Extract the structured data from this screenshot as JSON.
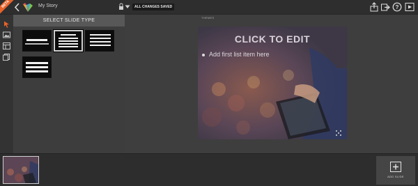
{
  "header": {
    "beta_label": "BETA",
    "story_title": "My Story",
    "save_status": "ALL CHANGES SAVED",
    "icons": [
      "back-icon",
      "logo-icon",
      "lock-icon",
      "chevron-down-icon",
      "share-icon",
      "exit-icon",
      "help-icon",
      "play-icon"
    ]
  },
  "rail": {
    "icons": [
      "pointer-icon",
      "image-icon",
      "layout-icon",
      "pages-icon"
    ]
  },
  "slide_type_panel": {
    "header": "SELECT SLIDE TYPE",
    "layouts": [
      "title-layout",
      "title-bullets-layout",
      "bullets-layout",
      "text-block-layout"
    ],
    "selected_layout": "title-bullets-layout"
  },
  "canvas": {
    "themes_label": "THEMES",
    "slide": {
      "title": "CLICK TO EDIT",
      "bullet_item": "Add first list item here"
    }
  },
  "filmstrip": {
    "add_slide_label": "ADD SLIDE"
  },
  "colors": {
    "accent": "#e8632a",
    "background": "#3b3b3b",
    "panel_header": "#585858"
  }
}
